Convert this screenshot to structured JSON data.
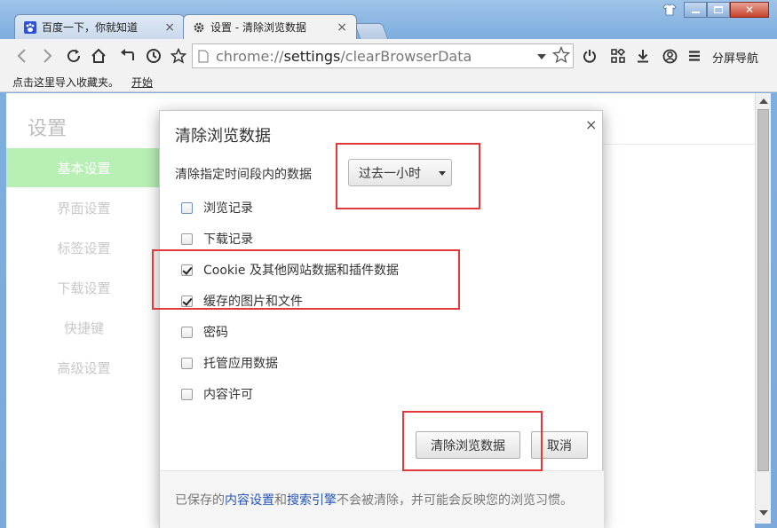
{
  "window": {
    "tabs": [
      {
        "title": "百度一下，你就知道",
        "active": false,
        "icon": "baidu-paw-icon"
      },
      {
        "title": "设置 - 清除浏览数据",
        "active": true,
        "icon": "gear-icon"
      }
    ],
    "close_tab_glyph": "×"
  },
  "toolbar": {
    "url_scheme": "chrome://",
    "url_host": "settings",
    "url_path": "/clearBrowserData",
    "split_label": "分屏导航"
  },
  "bookmarks": {
    "hint": "点击这里导入收藏夹。",
    "start": "开始"
  },
  "settings": {
    "title": "设置",
    "nav": [
      {
        "label": "基本设置",
        "active": true
      },
      {
        "label": "界面设置",
        "active": false
      },
      {
        "label": "标签设置",
        "active": false
      },
      {
        "label": "下载设置",
        "active": false
      },
      {
        "label": "快捷键",
        "active": false
      },
      {
        "label": "高级设置",
        "active": false
      }
    ]
  },
  "dialog": {
    "title": "清除浏览数据",
    "close_glyph": "×",
    "range_label": "清除指定时间段内的数据",
    "range_value": "过去一小时",
    "options": [
      {
        "label": "浏览记录",
        "checked": false
      },
      {
        "label": "下载记录",
        "checked": false
      },
      {
        "label": "Cookie 及其他网站数据和插件数据",
        "checked": true
      },
      {
        "label": "缓存的图片和文件",
        "checked": true
      },
      {
        "label": "密码",
        "checked": false
      },
      {
        "label": "托管应用数据",
        "checked": false
      },
      {
        "label": "内容许可",
        "checked": false
      }
    ],
    "clear_button": "清除浏览数据",
    "cancel_button": "取消",
    "footer": {
      "prefix": "已保存的",
      "link1": "内容设置",
      "middle": "和",
      "link2": "搜索引擎",
      "suffix": "不会被清除，并可能会反映您的浏览习惯。"
    }
  },
  "colors": {
    "annotation": "#e03a3a",
    "active_nav": "#b8efb5",
    "link": "#2455b8"
  }
}
